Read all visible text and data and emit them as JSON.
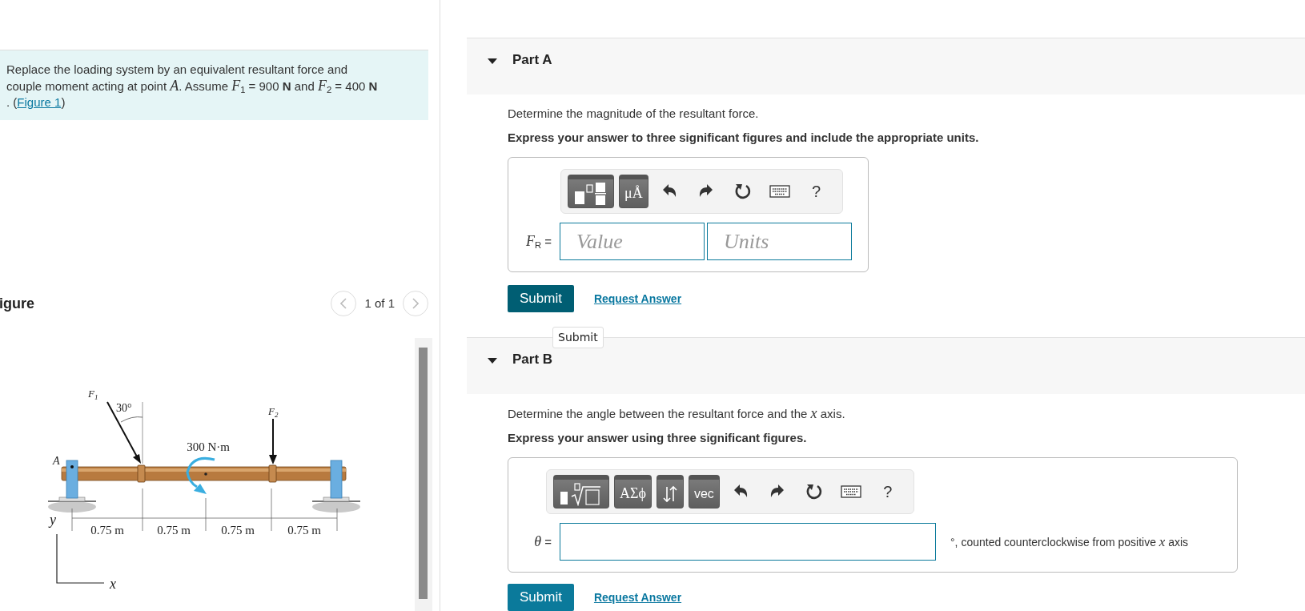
{
  "problem": {
    "text": "Replace the loading system by an equivalent resultant force and couple moment acting at point *A*. Assume *F*$_{1}$ = 900 **N** and *F*$_{2}$ = 400 **N** . (",
    "link": "Figure 1",
    "text_after": ")"
  },
  "figure_panel": {
    "title": "igure",
    "pager": "1 of 1",
    "prev_disabled": true,
    "next_disabled": true,
    "diagram": {
      "forces": [
        {
          "symbol": "F",
          "index": "1"
        },
        {
          "symbol": "F",
          "index": "2"
        }
      ],
      "angle": "30°",
      "moment": "300 N·m",
      "point": "A",
      "axis_y": "y",
      "axis_x": "x",
      "spans": [
        "0.75 m",
        "0.75 m",
        "0.75 m",
        "0.75 m"
      ]
    }
  },
  "parts": [
    {
      "title": "Part A",
      "expanded": true,
      "prompt": "Determine the magnitude of the resultant force.",
      "instruction": "Express your answer to three significant figures and include the appropriate units.",
      "toolbar": [
        {
          "kind": "template"
        },
        {
          "kind": "palette",
          "label": "μÅ"
        },
        {
          "kind": "undo"
        },
        {
          "kind": "redo"
        },
        {
          "kind": "reset"
        },
        {
          "kind": "keyboard"
        },
        {
          "kind": "help",
          "label": "?"
        }
      ],
      "answer_label": "*F*$_{R}$ =",
      "fields": [
        {
          "kind": "hint",
          "placeholder": "Value"
        },
        {
          "kind": "hint",
          "placeholder": "Units"
        }
      ],
      "submit": {
        "label": "Submit",
        "hovered": true,
        "tooltip": "Submit"
      },
      "request_link": "Request Answer"
    },
    {
      "title": "Part B",
      "expanded": true,
      "prompt": "Determine the angle between the resultant force and the *x* axis.",
      "instruction": "Express your answer using three significant figures.",
      "toolbar": [
        {
          "kind": "radical"
        },
        {
          "kind": "palette",
          "label": "ΑΣϕ"
        },
        {
          "kind": "arrows"
        },
        {
          "kind": "palette",
          "label": "vec"
        },
        {
          "kind": "undo"
        },
        {
          "kind": "redo"
        },
        {
          "kind": "reset"
        },
        {
          "kind": "keyboard"
        },
        {
          "kind": "help",
          "label": "?"
        }
      ],
      "answer_label": "*θ* =",
      "fields": [
        {
          "kind": "blank"
        }
      ],
      "suffix": "°, counted counterclockwise from positive *x* axis",
      "submit": {
        "label": "Submit",
        "hovered": false
      },
      "request_link": "Request Answer"
    }
  ]
}
